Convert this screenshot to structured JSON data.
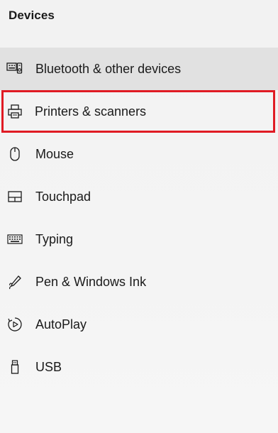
{
  "section": {
    "title": "Devices"
  },
  "nav": {
    "items": [
      {
        "label": "Bluetooth & other devices",
        "icon": "bluetooth-devices-icon",
        "state": "hovered"
      },
      {
        "label": "Printers & scanners",
        "icon": "printer-icon",
        "state": "highlighted"
      },
      {
        "label": "Mouse",
        "icon": "mouse-icon",
        "state": "normal"
      },
      {
        "label": "Touchpad",
        "icon": "touchpad-icon",
        "state": "normal"
      },
      {
        "label": "Typing",
        "icon": "keyboard-icon",
        "state": "normal"
      },
      {
        "label": "Pen & Windows Ink",
        "icon": "pen-icon",
        "state": "normal"
      },
      {
        "label": "AutoPlay",
        "icon": "autoplay-icon",
        "state": "normal"
      },
      {
        "label": "USB",
        "icon": "usb-icon",
        "state": "normal"
      }
    ]
  },
  "colors": {
    "highlight_border": "#e01b24",
    "hover_background": "#e1e1e1"
  }
}
